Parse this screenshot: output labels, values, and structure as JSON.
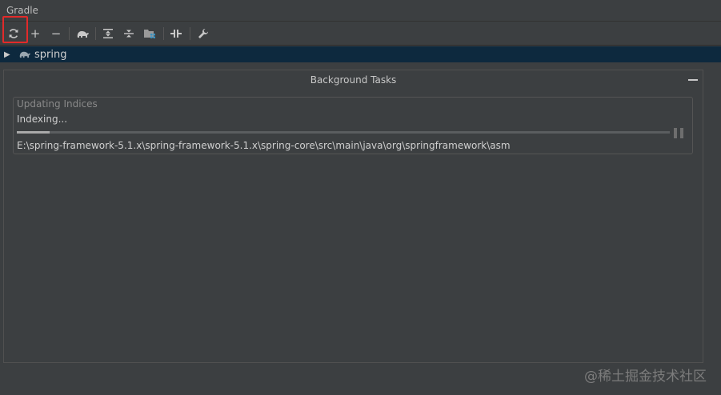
{
  "window": {
    "title": "Gradle"
  },
  "toolbar": {
    "buttons": [
      {
        "name": "refresh",
        "icon": "refresh-icon"
      },
      {
        "name": "add",
        "icon": "plus-icon",
        "glyph": "+"
      },
      {
        "name": "remove",
        "icon": "minus-icon",
        "glyph": "−"
      },
      {
        "name": "execute-task",
        "icon": "gradle-elephant-icon"
      },
      {
        "name": "expand-all",
        "icon": "expand-all-icon"
      },
      {
        "name": "collapse-all",
        "icon": "collapse-all-icon"
      },
      {
        "name": "group-modules",
        "icon": "folder-grid-icon"
      },
      {
        "name": "toggle-offline",
        "icon": "offline-toggle-icon"
      },
      {
        "name": "settings",
        "icon": "wrench-icon"
      }
    ],
    "highlight_color": "#e22a2a"
  },
  "tree": {
    "selected_row": {
      "label": "spring",
      "icon": "gradle-elephant-icon"
    }
  },
  "background_tasks": {
    "title": "Background Tasks",
    "task": {
      "group_title": "Updating Indices",
      "status": "Indexing...",
      "progress": 0.05,
      "path": "E:\\spring-framework-5.1.x\\spring-framework-5.1.x\\spring-core\\src\\main\\java\\org\\springframework\\asm"
    }
  },
  "watermark": {
    "text": "@稀土掘金技术社区"
  },
  "colors": {
    "background": "#3c3f41",
    "selection": "#0d293e",
    "text": "#bbbbbb"
  }
}
